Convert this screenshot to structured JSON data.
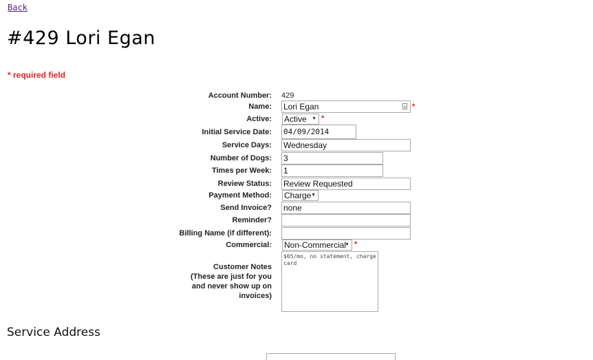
{
  "nav": {
    "back_label": "Back"
  },
  "page": {
    "title": "#429 Lori Egan",
    "required_note": "* required field",
    "required_mark": "*"
  },
  "form": {
    "account_number": {
      "label": "Account Number:",
      "value": "429"
    },
    "name": {
      "label": "Name:",
      "value": "Lori Egan"
    },
    "active": {
      "label": "Active:",
      "value": "Active"
    },
    "initial_service_date": {
      "label": "Initial Service Date:",
      "value": "04/09/2014"
    },
    "service_days": {
      "label": "Service Days:",
      "value": "Wednesday"
    },
    "number_of_dogs": {
      "label": "Number of Dogs:",
      "value": "3"
    },
    "times_per_week": {
      "label": "Times per Week:",
      "value": "1"
    },
    "review_status": {
      "label": "Review Status:",
      "value": "Review Requested"
    },
    "payment_method": {
      "label": "Payment Method:",
      "value": "Charge"
    },
    "send_invoice": {
      "label": "Send Invoice?",
      "value": "none"
    },
    "reminder": {
      "label": "Reminder?",
      "value": ""
    },
    "billing_name": {
      "label": "Billing Name (if different):",
      "value": ""
    },
    "commercial": {
      "label": "Commercial:",
      "value": "Non-Commercial"
    },
    "customer_notes": {
      "label_line1": "Customer Notes",
      "label_line2": "(These are just for you",
      "label_line3": "and never show up on",
      "label_line4": "invoices)",
      "value": "$65/mo, no statement, charge card"
    }
  },
  "service_address": {
    "title": "Service Address"
  },
  "icons": {
    "select_caret": "chevron-down-icon",
    "name_field_icon": "keyboard-icon"
  },
  "colors": {
    "required": "#e02020",
    "link": "#551a8b"
  }
}
